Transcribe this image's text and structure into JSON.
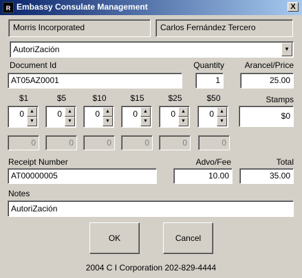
{
  "window": {
    "title": "Embassy Consulate Management",
    "icon_text": "R",
    "close_glyph": "X"
  },
  "header": {
    "company": "Morris  Incorporated",
    "person": "Carlos Fernández Tercero"
  },
  "service_select": {
    "selected": "AutoriZación"
  },
  "document": {
    "id_label": "Document Id",
    "id_value": "AT05AZ0001",
    "quantity_label": "Quantity",
    "quantity_value": "1",
    "price_label": "Arancel/Price",
    "price_value": "25.00"
  },
  "denominations": [
    {
      "label": "$1",
      "value": "0",
      "subtotal": "0"
    },
    {
      "label": "$5",
      "value": "0",
      "subtotal": "0"
    },
    {
      "label": "$10",
      "value": "0",
      "subtotal": "0"
    },
    {
      "label": "$15",
      "value": "0",
      "subtotal": "0"
    },
    {
      "label": "$25",
      "value": "0",
      "subtotal": "0"
    },
    {
      "label": "$50",
      "value": "0",
      "subtotal": "0"
    }
  ],
  "stamps": {
    "label": "Stamps",
    "value": "$0"
  },
  "receipt": {
    "label": "Receipt Number",
    "value": "AT00000005",
    "fee_label": "Advo/Fee",
    "fee_value": "10.00",
    "total_label": "Total",
    "total_value": "35.00"
  },
  "notes": {
    "label": "Notes",
    "value": "AutoriZación"
  },
  "buttons": {
    "ok": "OK",
    "cancel": "Cancel"
  },
  "footer": "2004 C I Corporation 202-829-4444",
  "icons": {
    "dropdown": "chevron-down-icon",
    "spin_up": "arrow-up-icon",
    "spin_down": "arrow-down-icon"
  }
}
